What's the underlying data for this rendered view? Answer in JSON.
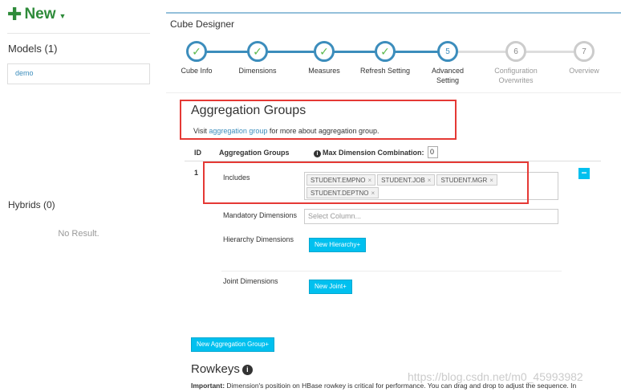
{
  "sidebar": {
    "new_label": "New",
    "models_title": "Models (1)",
    "models": [
      "demo"
    ],
    "hybrids_title": "Hybrids (0)",
    "no_result": "No Result."
  },
  "designer": {
    "title": "Cube Designer",
    "steps": [
      {
        "label": "Cube Info",
        "state": "done",
        "marker": "✓"
      },
      {
        "label": "Dimensions",
        "state": "done",
        "marker": "✓"
      },
      {
        "label": "Measures",
        "state": "done",
        "marker": "✓"
      },
      {
        "label": "Refresh Setting",
        "state": "done",
        "marker": "✓"
      },
      {
        "label": "Advanced Setting",
        "state": "current",
        "marker": "5"
      },
      {
        "label": "Configuration Overwrites",
        "state": "pending",
        "marker": "6"
      },
      {
        "label": "Overview",
        "state": "pending",
        "marker": "7"
      }
    ],
    "colors": {
      "accent": "#3c8dbc",
      "check": "#5bb84a",
      "pending": "#cccccc",
      "button": "#00c0ef",
      "highlight_box": "#e53935"
    }
  },
  "aggregation": {
    "title": "Aggregation Groups",
    "visit_prefix": "Visit ",
    "visit_link": "aggregation group",
    "visit_suffix": " for more about aggregation group.",
    "col_id": "ID",
    "col_groups": "Aggregation Groups",
    "max_dim_label": "Max Dimension Combination:",
    "max_dim_value": "0",
    "group": {
      "id": "1",
      "includes_label": "Includes",
      "includes": [
        "STUDENT.EMPNO",
        "STUDENT.JOB",
        "STUDENT.MGR",
        "STUDENT.DEPTNO"
      ],
      "mandatory_label": "Mandatory Dimensions",
      "mandatory_placeholder": "Select Column...",
      "hierarchy_label": "Hierarchy Dimensions",
      "new_hierarchy_btn": "New Hierarchy+",
      "joint_label": "Joint Dimensions",
      "new_joint_btn": "New Joint+",
      "remove_btn": "−"
    },
    "new_group_btn": "New Aggregation Group+"
  },
  "rowkeys": {
    "title": "Rowkeys",
    "important_label": "Important:",
    "important_text": " Dimension's positioin on HBase rowkey is critical for performance. You can drag and drop to adjust the sequence. In"
  },
  "watermark": "https://blog.csdn.net/m0_45993982"
}
